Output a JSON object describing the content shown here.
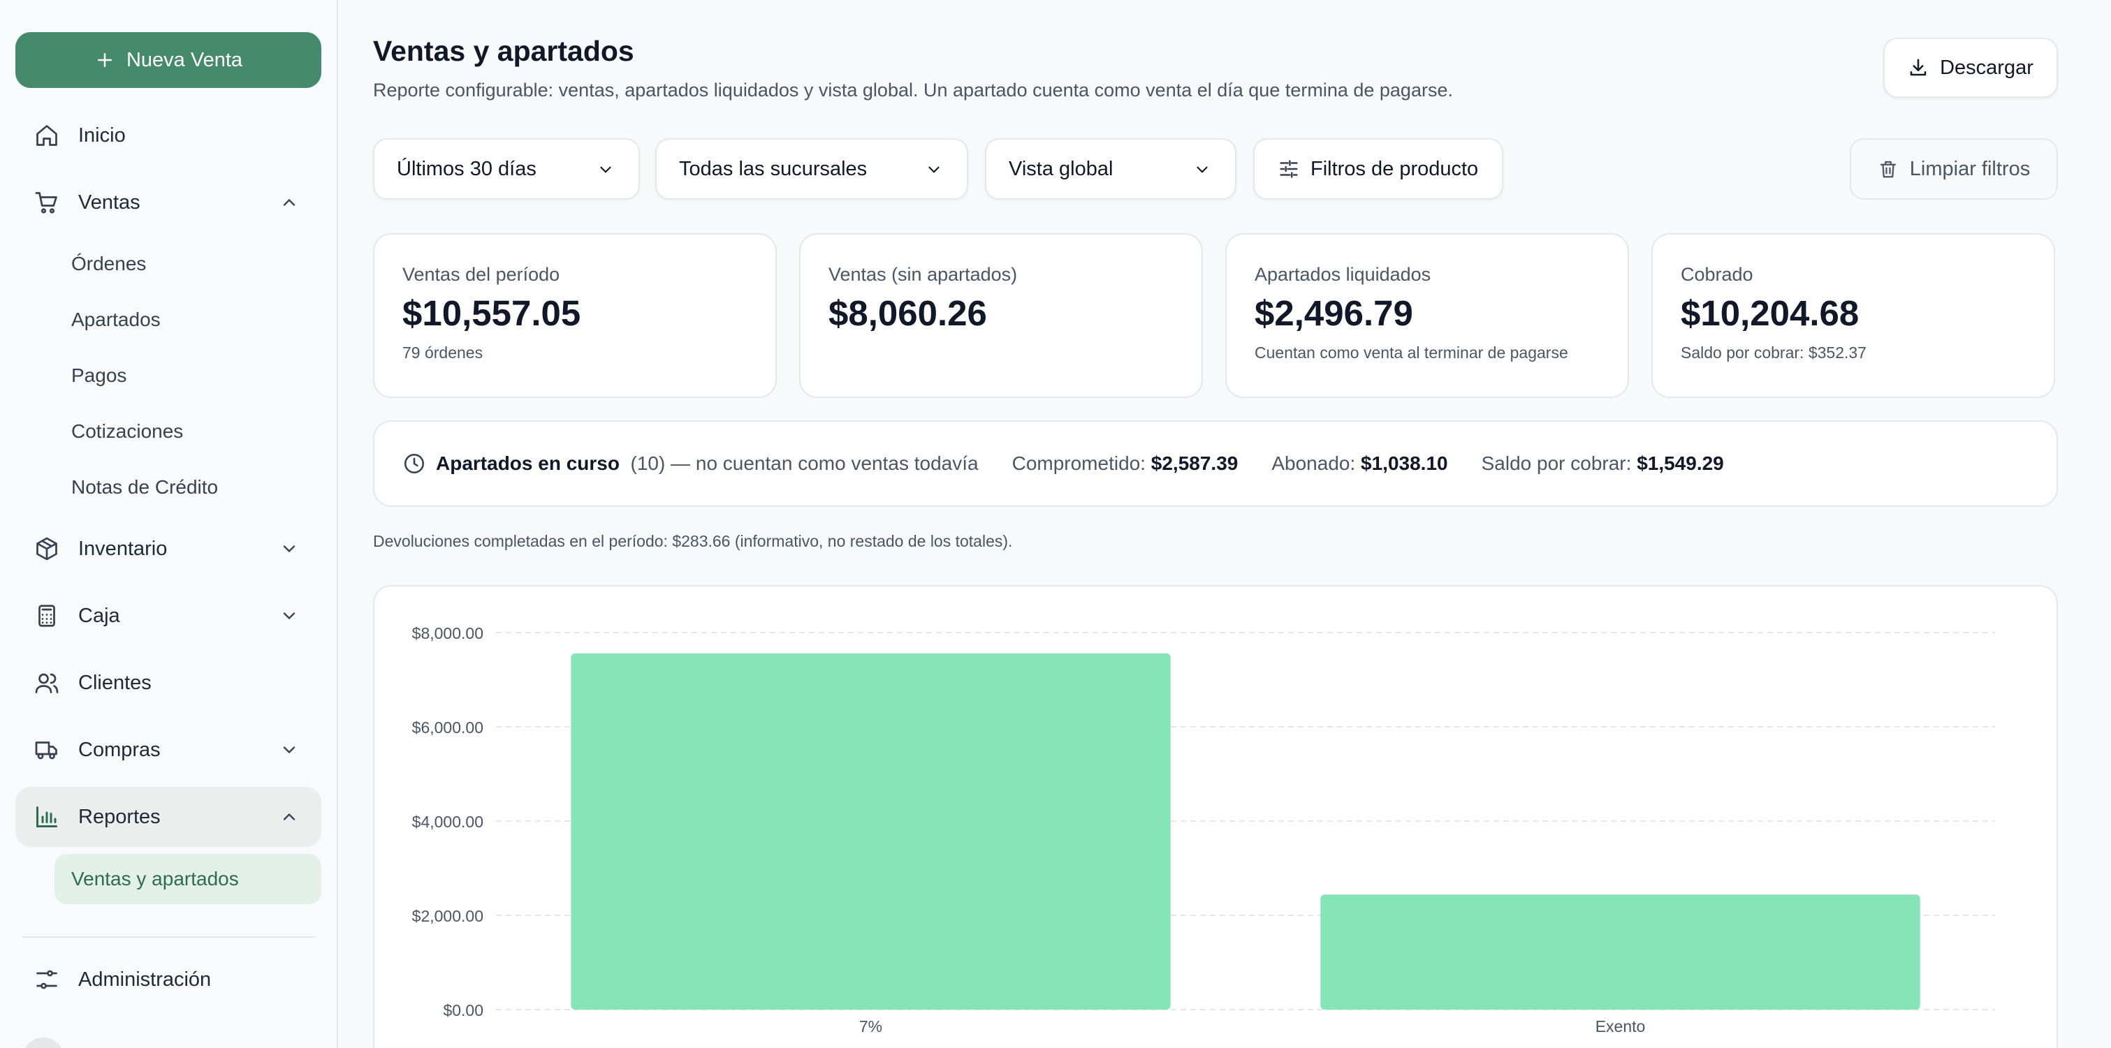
{
  "sidebar": {
    "new_sale": "Nueva Venta",
    "items": {
      "inicio": "Inicio",
      "ventas": "Ventas",
      "inventario": "Inventario",
      "caja": "Caja",
      "clientes": "Clientes",
      "compras": "Compras",
      "reportes": "Reportes",
      "administracion": "Administración"
    },
    "ventas_sub": [
      "Órdenes",
      "Apartados",
      "Pagos",
      "Cotizaciones",
      "Notas de Crédito"
    ],
    "reportes_sub": [
      "Ventas y apartados"
    ]
  },
  "header": {
    "title": "Ventas y apartados",
    "subtitle": "Reporte configurable: ventas, apartados liquidados y vista global. Un apartado cuenta como venta el día que termina de pagarse.",
    "download": "Descargar"
  },
  "filters": {
    "period": "Últimos 30 días",
    "branch": "Todas las sucursales",
    "view": "Vista global",
    "product": "Filtros de producto",
    "clear": "Limpiar filtros"
  },
  "stats": [
    {
      "label": "Ventas del período",
      "value": "$10,557.05",
      "note": "79 órdenes"
    },
    {
      "label": "Ventas (sin apartados)",
      "value": "$8,060.26",
      "note": ""
    },
    {
      "label": "Apartados liquidados",
      "value": "$2,496.79",
      "note": "Cuentan como venta al terminar de pagarse"
    },
    {
      "label": "Cobrado",
      "value": "$10,204.68",
      "note": "Saldo por cobrar: $352.37"
    }
  ],
  "in_progress": {
    "title": "Apartados en curso",
    "desc": "(10) — no cuentan como ventas todavía",
    "committed_label": "Comprometido:",
    "committed_value": "$2,587.39",
    "paid_label": "Abonado:",
    "paid_value": "$1,038.10",
    "balance_label": "Saldo por cobrar:",
    "balance_value": "$1,549.29"
  },
  "returns_note": "Devoluciones completadas en el período: $283.66 (informativo, no restado de los totales).",
  "colors": {
    "accent": "#448a6b",
    "bar": "#86e5b6"
  },
  "chart_data": {
    "type": "bar",
    "categories": [
      "7%",
      "Exento"
    ],
    "values": [
      7560,
      2440
    ],
    "ylim": [
      0,
      8000
    ],
    "yticks": [
      {
        "v": 0,
        "label": "$0.00"
      },
      {
        "v": 2000,
        "label": "$2,000.00"
      },
      {
        "v": 4000,
        "label": "$4,000.00"
      },
      {
        "v": 6000,
        "label": "$6,000.00"
      },
      {
        "v": 8000,
        "label": "$8,000.00"
      }
    ],
    "grid": true
  }
}
